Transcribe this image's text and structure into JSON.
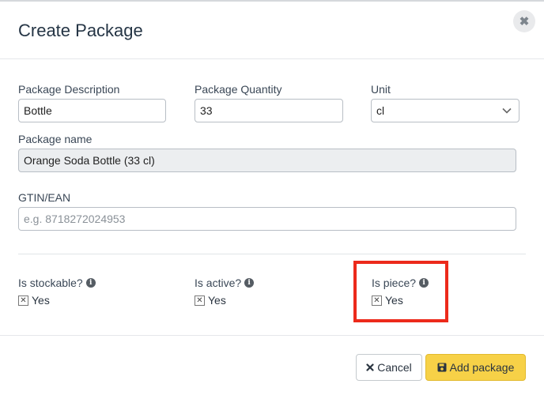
{
  "modal": {
    "title": "Create Package",
    "close_icon": "close-icon"
  },
  "form": {
    "package_description": {
      "label": "Package Description",
      "value": "Bottle"
    },
    "package_quantity": {
      "label": "Package Quantity",
      "value": "33"
    },
    "unit": {
      "label": "Unit",
      "value": "cl"
    },
    "package_name": {
      "label": "Package name",
      "value": "Orange Soda Bottle (33 cl)"
    },
    "gtin": {
      "label": "GTIN/EAN",
      "value": "",
      "placeholder": "e.g. 8718272024953"
    }
  },
  "flags": {
    "stockable": {
      "label": "Is stockable?",
      "option": "Yes",
      "checked": true
    },
    "active": {
      "label": "Is active?",
      "option": "Yes",
      "checked": true
    },
    "piece": {
      "label": "Is piece?",
      "option": "Yes",
      "checked": true
    }
  },
  "footer": {
    "cancel_label": "Cancel",
    "add_label": "Add package"
  },
  "colors": {
    "highlight": "#ec2a1b",
    "primary_button": "#f7d147"
  }
}
